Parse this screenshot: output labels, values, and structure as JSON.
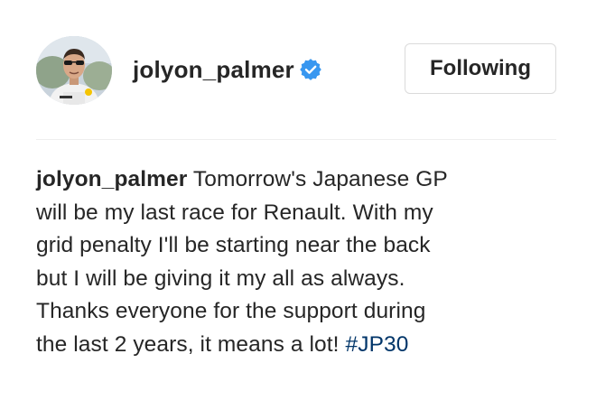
{
  "header": {
    "username": "jolyon_palmer",
    "verified": true,
    "follow_button_label": "Following",
    "avatar_icon": "profile-photo"
  },
  "caption": {
    "username": "jolyon_palmer",
    "lines": [
      "Tomorrow's Japanese GP",
      "will be my last race for Renault. With my",
      "grid penalty I'll be starting near the back",
      "but I will be giving it my all as always.",
      "Thanks everyone for the support during",
      "the last 2 years, it means a lot!"
    ],
    "hashtag": "#JP30"
  },
  "colors": {
    "text": "#262626",
    "verified_badge": "#3897f0",
    "hashtag": "#003569",
    "border": "#dbdbdb"
  }
}
